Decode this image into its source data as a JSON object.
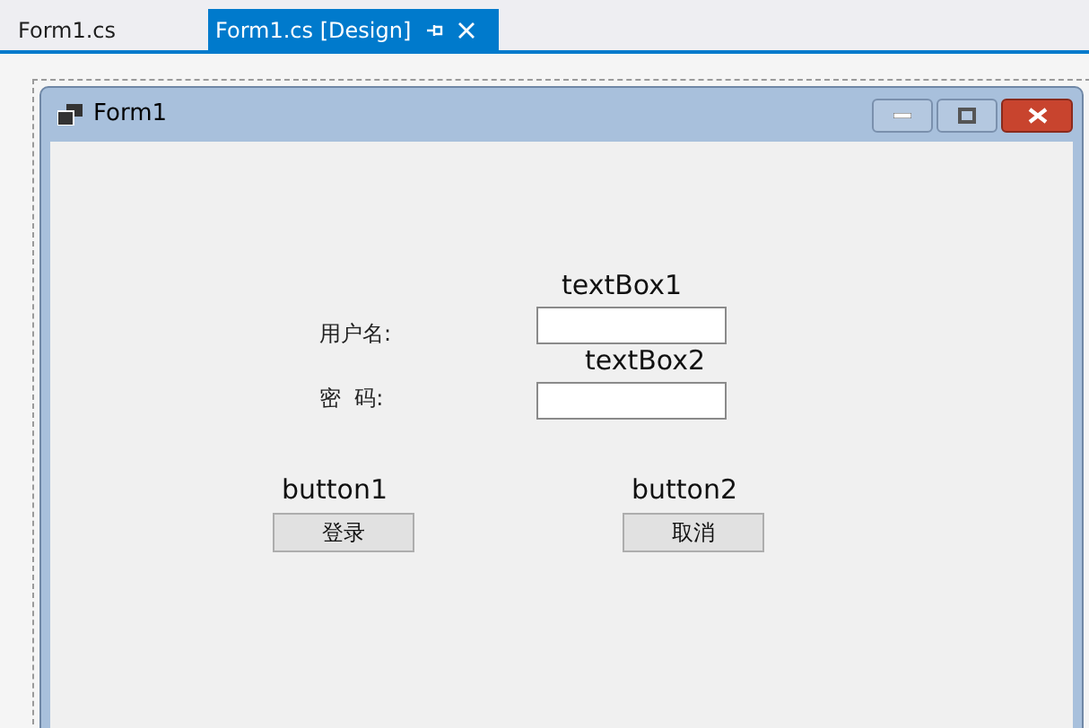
{
  "tabs": [
    {
      "label": "Form1.cs",
      "selected": false
    },
    {
      "label": "Form1.cs [Design]",
      "selected": true
    }
  ],
  "form": {
    "title": "Form1",
    "controls": [
      {
        "kind": "label",
        "text": "用户名:"
      },
      {
        "kind": "textbox",
        "name": "textBox1"
      },
      {
        "kind": "label",
        "text": "密  码:"
      },
      {
        "kind": "textbox",
        "name": "textBox2"
      },
      {
        "kind": "button",
        "name": "button1",
        "text": "登录"
      },
      {
        "kind": "button",
        "name": "button2",
        "text": "取消"
      }
    ]
  }
}
